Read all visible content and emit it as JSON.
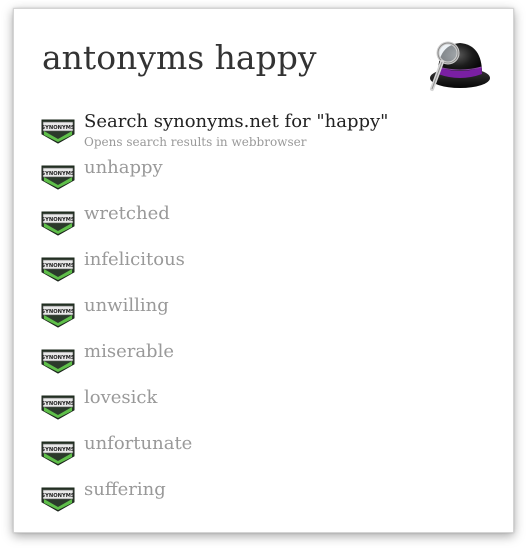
{
  "query": {
    "text": "antonyms happy"
  },
  "app_icon": "alfred-bowler-hat-icon",
  "result_icon": {
    "name": "synonyms-badge-icon",
    "label": "SYNONYMS",
    "colors": {
      "green": "#5fbf4a",
      "dark": "#2b3a2b"
    }
  },
  "results": [
    {
      "title": "Search synonyms.net for \"happy\"",
      "subtitle": "Opens search results in webbrowser",
      "selected": true
    },
    {
      "title": "unhappy"
    },
    {
      "title": "wretched"
    },
    {
      "title": "infelicitous"
    },
    {
      "title": "unwilling"
    },
    {
      "title": "miserable"
    },
    {
      "title": "lovesick"
    },
    {
      "title": "unfortunate"
    },
    {
      "title": "suffering"
    }
  ]
}
